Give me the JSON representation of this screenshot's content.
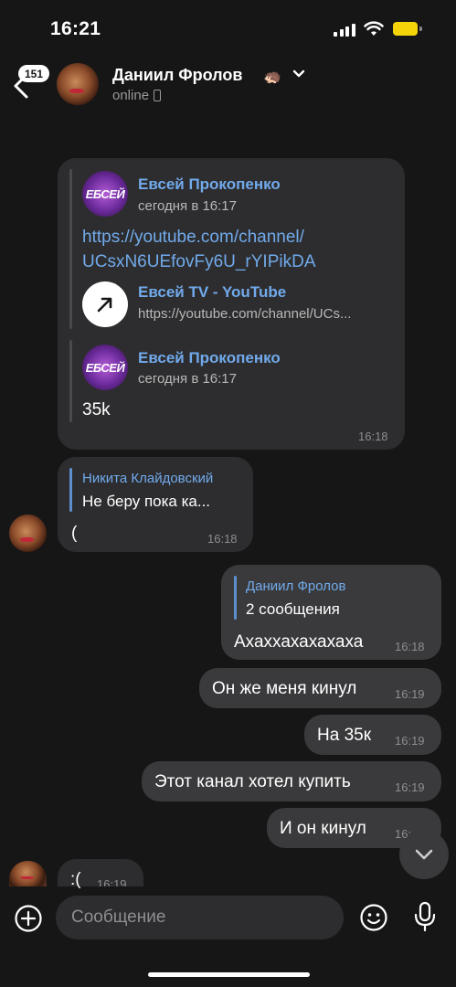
{
  "status_bar": {
    "time": "16:21"
  },
  "header": {
    "back_badge": "151",
    "name": "Даниил Фролов",
    "emoji": "🦔",
    "status": "online"
  },
  "forwarded_card": {
    "items": [
      {
        "author": "Евсей Прокопенко",
        "date": "сегодня в 16:17",
        "link_line1": "https://youtube.com/channel/",
        "link_line2": "UCsxN6UEfovFy6U_rYIPikDA",
        "preview_title": "Евсей TV - YouTube",
        "preview_url": "https://youtube.com/channel/UCs..."
      },
      {
        "author": "Евсей Прокопенко",
        "date": "сегодня в 16:17",
        "text": "35k"
      }
    ],
    "avatar_text": "ЕБСЕЙ",
    "time": "16:18"
  },
  "messages": [
    {
      "reply_name": "Никита Клайдовский",
      "reply_text": "Не беру пока ка...",
      "text": "(",
      "time": "16:18"
    },
    {
      "reply_name": "Даниил Фролов",
      "reply_text": "2 сообщения",
      "text": "Ахаххахахахаха",
      "time": "16:18"
    },
    {
      "text": "Он же меня кинул",
      "time": "16:19"
    },
    {
      "text": "На 35к",
      "time": "16:19"
    },
    {
      "text": "Этот канал хотел купить",
      "time": "16:19"
    },
    {
      "text": "И он кинул",
      "time": "16:"
    },
    {
      "text": ":(",
      "time": "16:19"
    }
  ],
  "composer": {
    "placeholder": "Сообщение"
  },
  "colors": {
    "accent": "#71aaeb",
    "background": "#161616",
    "bubble_in": "#2d2d2f",
    "bubble_out": "#3a3a3c"
  },
  "icons": [
    "back-arrow-icon",
    "chevron-down-icon",
    "phone-icon",
    "link-arrow-icon",
    "scroll-down-icon",
    "plus-icon",
    "emoji-icon",
    "microphone-icon"
  ]
}
